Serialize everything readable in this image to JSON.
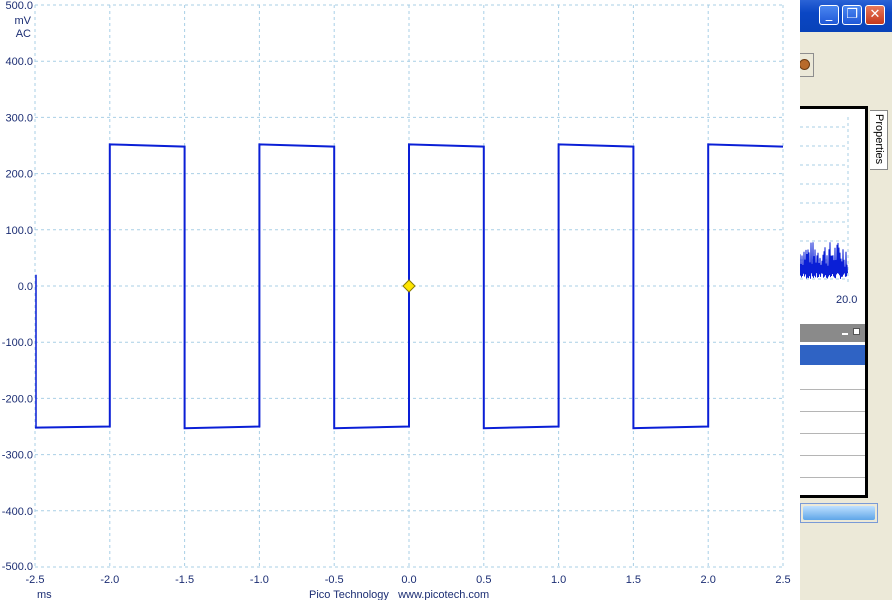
{
  "colors": {
    "trace": "#0a1fd6",
    "grid": "#a9cfe6",
    "axis_text": "#1b2d73",
    "trigger_marker": "#ffe600",
    "titlebar": "#0a46c4",
    "selection": "#2f63c4"
  },
  "scope": {
    "y_unit": "mV",
    "coupling": "AC",
    "x_unit": "ms",
    "footer": "Pico Technology   www.picotech.com"
  },
  "side_window": {
    "properties_tab": "Properties",
    "mini_axis_label": "20.0",
    "buttons": {
      "minimize_icon": "minimize-icon",
      "maximize_icon": "restore-icon",
      "close_icon": "close-icon"
    }
  },
  "chart_data": {
    "type": "line",
    "xlabel": "ms",
    "ylabel": "mV",
    "xlim": [
      -2.5,
      2.5
    ],
    "ylim": [
      -500,
      500
    ],
    "x_ticks": [
      "-2.5",
      "-2.0",
      "-1.5",
      "-1.0",
      "-0.5",
      "0.0",
      "0.5",
      "1.0",
      "1.5",
      "2.0",
      "2.5"
    ],
    "y_ticks": [
      "500.0",
      "400.0",
      "300.0",
      "200.0",
      "100.0",
      "0.0",
      "-100.0",
      "-200.0",
      "-300.0",
      "-400.0",
      "-500.0"
    ],
    "grid": true,
    "trigger": {
      "x": 0.0,
      "y": 0.0
    },
    "series": [
      {
        "x": [
          -2.5,
          -2.0,
          -2.0,
          -1.5,
          -1.5,
          -1.0,
          -1.0,
          -0.5,
          -0.5,
          0.0,
          0.0,
          0.5,
          0.5,
          1.0,
          1.0,
          1.5,
          1.5,
          2.0,
          2.0,
          2.5
        ],
        "values": [
          -252,
          -250,
          252,
          248,
          -253,
          -250,
          252,
          248,
          -253,
          -250,
          252,
          248,
          -253,
          -250,
          252,
          248,
          -253,
          -250,
          252,
          248
        ]
      }
    ]
  }
}
